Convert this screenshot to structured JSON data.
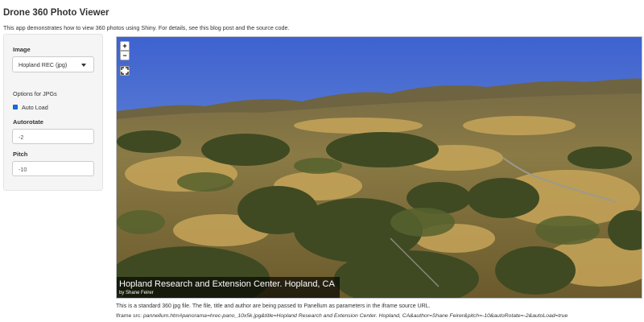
{
  "app": {
    "title": "Drone 360 Photo Viewer",
    "description": "This app demonstrates how to view 360 photos using Shiny. For details, see this blog post and the source code."
  },
  "sidebar": {
    "image_label": "Image",
    "image_selected": "Hopland REC (jpg)",
    "options_label": "Options for JPGs",
    "autoload_label": "Auto Load",
    "autoload_checked": true,
    "autorotate_label": "Autorotate",
    "autorotate_value": "-2",
    "pitch_label": "Pitch",
    "pitch_value": "-10"
  },
  "viewer": {
    "zoom_in": "+",
    "zoom_out": "−",
    "fullscreen_icon": "fullscreen-icon",
    "panorama_title": "Hopland Research and Extension Center. Hopland, CA",
    "panorama_author": "by Shane Feirer"
  },
  "footer": {
    "caption": "This is a standard 360 jpg file. The file, title and author are being passed to Panellum as parameters in the iframe source URL.",
    "iframe_prefix": "Iframe src: ",
    "iframe_url": "pannellum.htm#panorama=hrec-pano_10x5k.jpg&title=Hopland Research and Extension Center. Hopland, CA&author=Shane Feirer&pitch=-10&autoRotate=-2&autoLoad=true"
  },
  "colors": {
    "sky_top": "#3e62cf",
    "sky_horizon": "#8fa8d8",
    "hills": "#6b6140",
    "grass": "#c9a75a",
    "trees": "#3f4a22"
  }
}
